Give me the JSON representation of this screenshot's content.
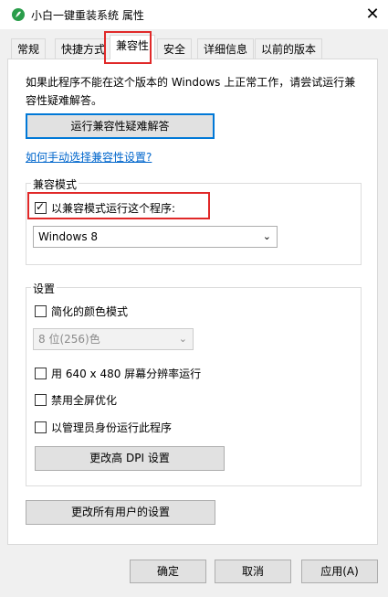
{
  "window": {
    "title": "小白一键重装系统 属性",
    "close_glyph": "✕",
    "icon": "app-logo-icon"
  },
  "tabs": [
    {
      "label": "常规"
    },
    {
      "label": "快捷方式"
    },
    {
      "label": "兼容性",
      "active": true
    },
    {
      "label": "安全"
    },
    {
      "label": "详细信息"
    },
    {
      "label": "以前的版本"
    }
  ],
  "info_text": "如果此程序不能在这个版本的 Windows 上正常工作，请尝试运行兼容性疑难解答。",
  "troubleshooter_button": "运行兼容性疑难解答",
  "manual_link": "如何手动选择兼容性设置?",
  "compat_group": {
    "title": "兼容模式",
    "checkbox_label": "以兼容模式运行这个程序:",
    "checked": true,
    "os_select_value": "Windows 8"
  },
  "settings_group": {
    "title": "设置",
    "reduced_color": {
      "label": "简化的颜色模式",
      "checked": false
    },
    "color_select_value": "8 位(256)色",
    "res_640": {
      "label": "用 640 x 480 屏幕分辨率运行",
      "checked": false
    },
    "disable_fullscreen": {
      "label": "禁用全屏优化",
      "checked": false
    },
    "run_as_admin": {
      "label": "以管理员身份运行此程序",
      "checked": false
    },
    "dpi_button": "更改高 DPI 设置"
  },
  "all_users_button": "更改所有用户的设置",
  "footer": {
    "ok": "确定",
    "cancel": "取消",
    "apply": "应用(A)"
  },
  "colors": {
    "highlight": "#e02828",
    "link": "#0066cc",
    "focus": "#0078d7"
  }
}
